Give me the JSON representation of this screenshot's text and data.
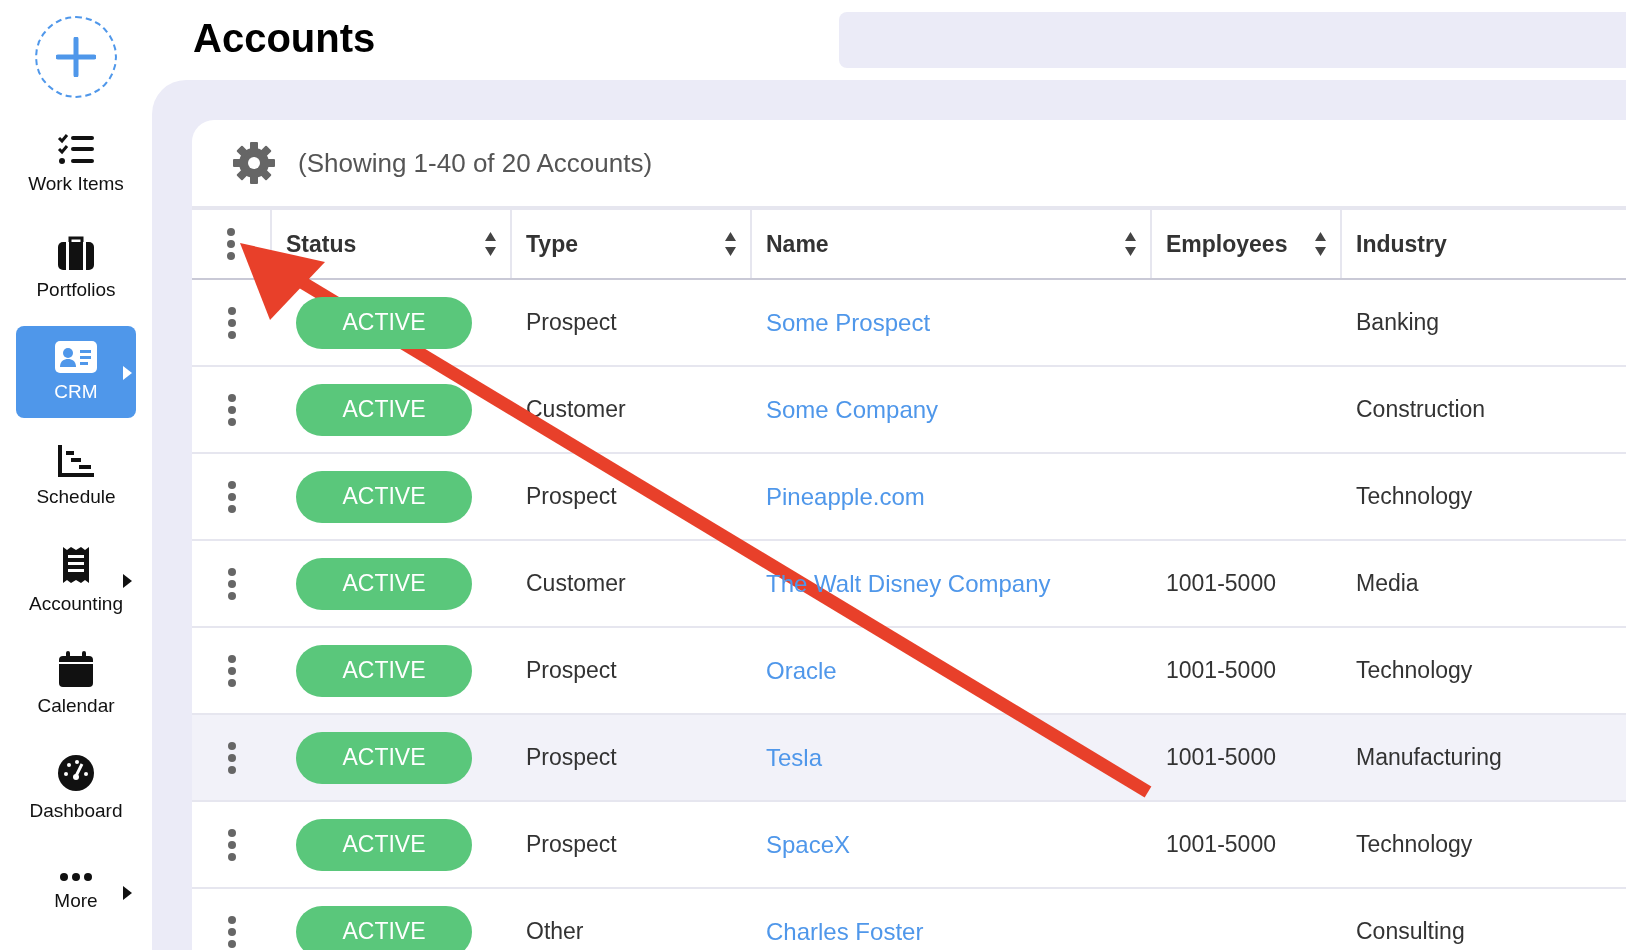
{
  "sidebar": {
    "items": [
      {
        "label": "Work Items",
        "selected": false,
        "has_submenu": false
      },
      {
        "label": "Portfolios",
        "selected": false,
        "has_submenu": false
      },
      {
        "label": "CRM",
        "selected": true,
        "has_submenu": true
      },
      {
        "label": "Schedule",
        "selected": false,
        "has_submenu": false
      },
      {
        "label": "Accounting",
        "selected": false,
        "has_submenu": true
      },
      {
        "label": "Calendar",
        "selected": false,
        "has_submenu": false
      },
      {
        "label": "Dashboard",
        "selected": false,
        "has_submenu": false
      },
      {
        "label": "More",
        "selected": false,
        "has_submenu": true
      }
    ]
  },
  "page_title": "Accounts",
  "summary": "(Showing 1-40 of 20 Accounts)",
  "table": {
    "columns": [
      {
        "label": "Status",
        "sortable": true
      },
      {
        "label": "Type",
        "sortable": true
      },
      {
        "label": "Name",
        "sortable": true
      },
      {
        "label": "Employees",
        "sortable": true
      },
      {
        "label": "Industry",
        "sortable": false
      }
    ],
    "rows": [
      {
        "status": "ACTIVE",
        "type": "Prospect",
        "name": "Some Prospect",
        "industry": "Banking",
        "selected": false
      },
      {
        "status": "ACTIVE",
        "type": "Customer",
        "name": "Some Company",
        "industry": "Construction",
        "selected": false
      },
      {
        "status": "ACTIVE",
        "type": "Prospect",
        "name": "Pineapple.com",
        "industry": "Technology",
        "selected": false
      },
      {
        "status": "ACTIVE",
        "type": "Customer",
        "name": "The Walt Disney Company",
        "employees": "1001-5000",
        "industry": "Media",
        "selected": false
      },
      {
        "status": "ACTIVE",
        "type": "Prospect",
        "name": "Oracle",
        "employees": "1001-5000",
        "industry": "Technology",
        "selected": false
      },
      {
        "status": "ACTIVE",
        "type": "Prospect",
        "name": "Tesla",
        "employees": "1001-5000",
        "industry": "Manufacturing",
        "selected": true
      },
      {
        "status": "ACTIVE",
        "type": "Prospect",
        "name": "SpaceX",
        "employees": "1001-5000",
        "industry": "Technology",
        "selected": false
      },
      {
        "status": "ACTIVE",
        "type": "Other",
        "name": "Charles Foster",
        "industry": "Consulting",
        "selected": false
      }
    ]
  }
}
